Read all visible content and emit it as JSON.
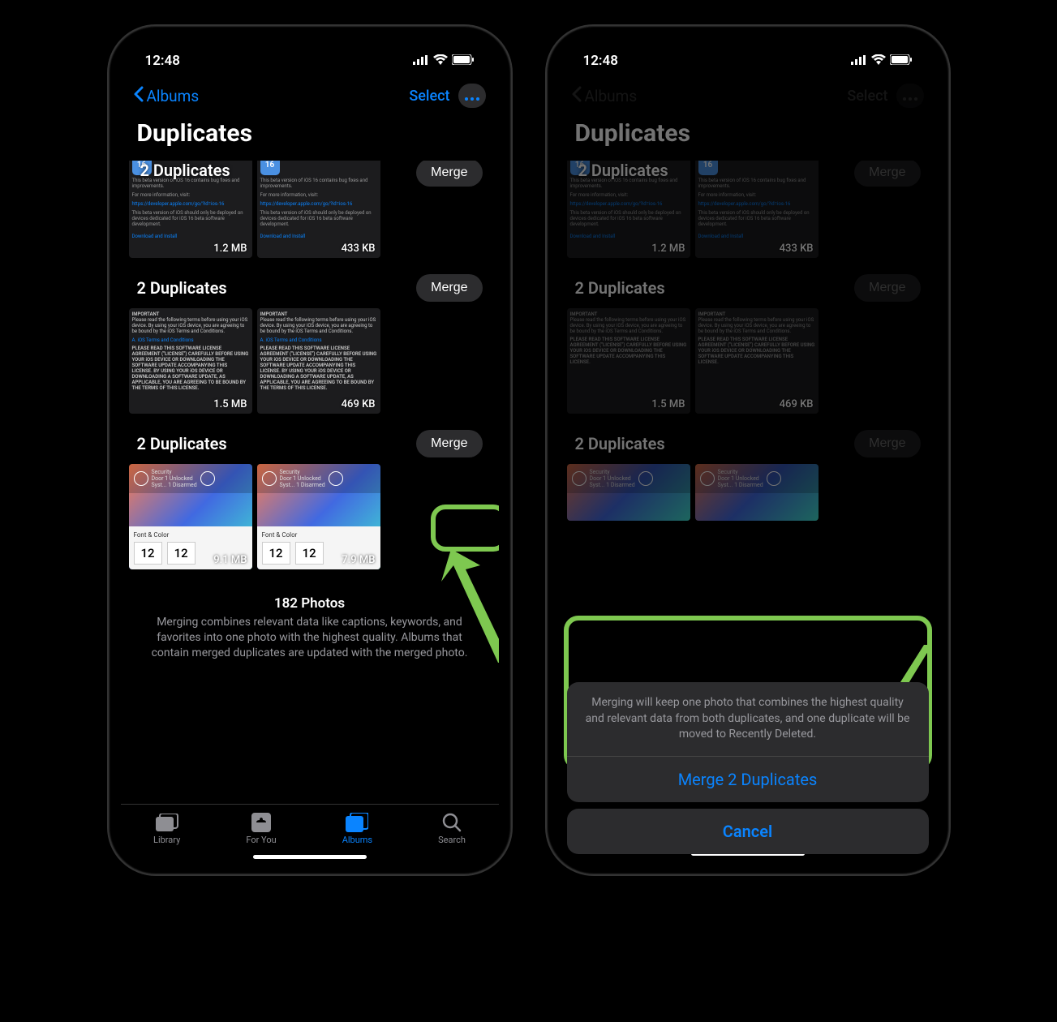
{
  "statusBar": {
    "time": "12:48"
  },
  "nav": {
    "back": "Albums",
    "select": "Select"
  },
  "title": "Duplicates",
  "groups": [
    {
      "label": "2 Duplicates",
      "merge": "Merge",
      "thumbs": [
        {
          "size": "1.2 MB",
          "link": "Download and Install",
          "icon": "16"
        },
        {
          "size": "433 KB",
          "link": "Download and Install",
          "icon": "16"
        }
      ]
    },
    {
      "label": "2 Duplicates",
      "merge": "Merge",
      "thumbs": [
        {
          "size": "1.5 MB",
          "heading": "IMPORTANT"
        },
        {
          "size": "469 KB",
          "heading": "IMPORTANT"
        }
      ]
    },
    {
      "label": "2 Duplicates",
      "merge": "Merge",
      "thumbs": [
        {
          "size": "9.1 MB",
          "card": "Font & Color",
          "num": "12"
        },
        {
          "size": "7.9 MB",
          "card": "Font & Color",
          "num": "12"
        }
      ]
    }
  ],
  "footer": {
    "count": "182 Photos",
    "desc": "Merging combines relevant data like captions, keywords, and favorites into one photo with the highest quality. Albums that contain merged duplicates are updated with the merged photo."
  },
  "tabs": {
    "library": "Library",
    "foryou": "For You",
    "albums": "Albums",
    "search": "Search"
  },
  "sheet": {
    "msg": "Merging will keep one photo that combines the highest quality and relevant data from both duplicates, and one duplicate will be moved to Recently Deleted.",
    "action": "Merge 2 Duplicates",
    "cancel": "Cancel"
  }
}
